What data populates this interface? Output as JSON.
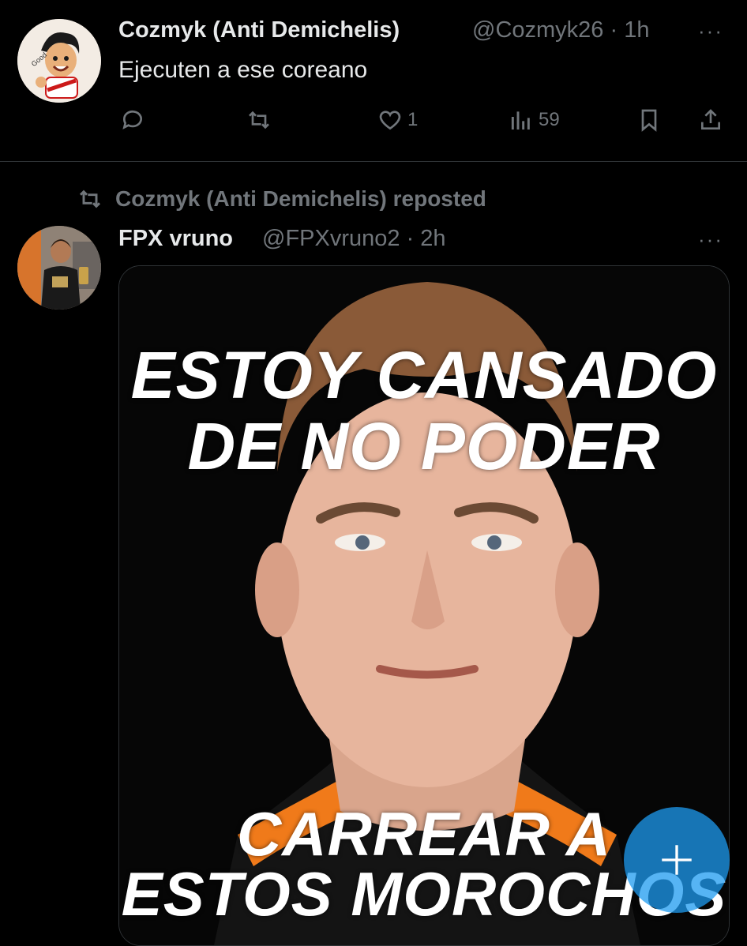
{
  "tweet1": {
    "author_name": "Cozmyk (Anti Demichelis)",
    "handle_time": "@Cozmyk26 · 1h",
    "more": "···",
    "text": "Ejecuten a ese coreano",
    "actions": {
      "reply_count": "",
      "repost_count": "",
      "like_count": "1",
      "views_count": "59"
    }
  },
  "repost_header": "Cozmyk (Anti Demichelis) reposted",
  "tweet2": {
    "author_name": "FPX vruno",
    "handle_time": "@FPXvruno2 · 2h",
    "more": "···",
    "meme": {
      "top_line1": "ESTOY CANSADO",
      "top_line2": "DE NO PODER",
      "bottom_line1": "CARREAR A",
      "bottom_line2": "ESTOS  MOROCHOS"
    }
  },
  "fab": {
    "icon": "compose-plus-icon",
    "color": "#1d9bf0"
  },
  "colors": {
    "background": "#000000",
    "text": "#e7e9ea",
    "muted": "#71767b",
    "jersey_orange": "#f07a1a"
  }
}
